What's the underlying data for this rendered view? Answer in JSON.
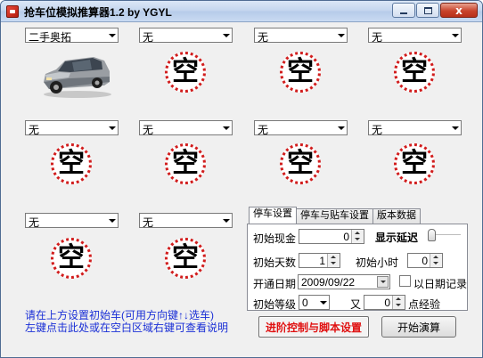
{
  "window": {
    "title": "抢车位模拟推算器1.2  by YGYL",
    "close_glyph": "x"
  },
  "slots": [
    {
      "select": "二手奥拓",
      "status": ""
    },
    {
      "select": "无",
      "status": "空"
    },
    {
      "select": "无",
      "status": "空"
    },
    {
      "select": "无",
      "status": "空"
    },
    {
      "select": "无",
      "status": "空"
    },
    {
      "select": "无",
      "status": "空"
    },
    {
      "select": "无",
      "status": "空"
    },
    {
      "select": "无",
      "status": "空"
    },
    {
      "select": "无",
      "status": "空"
    },
    {
      "select": "无",
      "status": "空"
    }
  ],
  "hints": {
    "line1": "请在上方设置初始车(可用方向键↑↓选车)",
    "line2": "左键点击此处或在空白区域右键可查看说明"
  },
  "tabs": [
    "停车设置",
    "停车与贴车设置",
    "版本数据"
  ],
  "settings": {
    "initial_cash_label": "初始现金",
    "initial_cash_value": "0",
    "show_delay_label": "显示延迟",
    "initial_days_label": "初始天数",
    "initial_days_value": "1",
    "initial_hours_label": "初始小时",
    "initial_hours_value": "0",
    "open_date_label": "开通日期",
    "open_date_value": "2009/09/22",
    "by_date_record_label": "以日期记录",
    "initial_level_label": "初始等级",
    "initial_level_value": "0",
    "and_label": "又",
    "exp_value": "0",
    "exp_label": "点经验"
  },
  "buttons": {
    "advanced": "进阶控制与脚本设置",
    "start": "开始演算"
  },
  "colors": {
    "slot_ring": "#d11d1d",
    "hint_text": "#1a2fd6",
    "advanced_text": "#e01010"
  }
}
